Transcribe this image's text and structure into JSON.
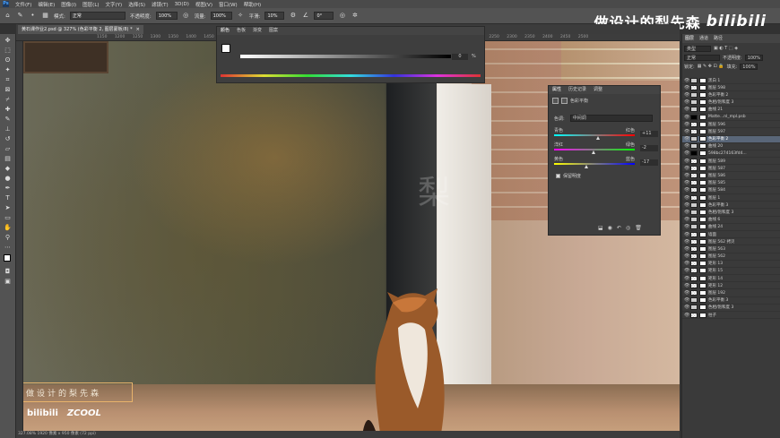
{
  "menubar": {
    "items": [
      "文件(F)",
      "编辑(E)",
      "图像(I)",
      "图层(L)",
      "文字(Y)",
      "选择(S)",
      "滤镜(T)",
      "3D(D)",
      "视图(V)",
      "窗口(W)",
      "帮助(H)"
    ]
  },
  "options": {
    "mode_label": "模式:",
    "mode_value": "正常",
    "opacity_label": "不透明度:",
    "opacity_value": "100%",
    "flow_label": "流量:",
    "flow_value": "100%",
    "smooth_label": "平滑:",
    "smooth_value": "10%",
    "angle_value": "0°"
  },
  "watermark": {
    "text": "做设计的梨先森",
    "brand": "bilibili"
  },
  "doc_tab": {
    "title": "黄石课作业2.psd @ 327% (色彩平衡 2, 图层蒙板/8) *",
    "close": "×"
  },
  "ruler_marks": "1150 1200 1250 1300 1350 1400 1450 1500 1550 1600 1650 1700 1750 1800 1850 1900 1950 2000 2050 2100 2150 2200 2250 2300 2350 2400 2450 2500",
  "canvas": {
    "watermark_char": "梨",
    "stamp_text": "做设计的梨先森",
    "logo1": "bilibili",
    "logo2": "ZCOOL"
  },
  "color_panel": {
    "tabs": [
      "颜色",
      "色板",
      "渐变",
      "图案"
    ],
    "value": "0",
    "unit": "%"
  },
  "properties": {
    "tabs": [
      "属性",
      "历史记录",
      "调整"
    ],
    "title": "色彩平衡",
    "tone_label": "色调:",
    "tone_value": "中间调",
    "sliders": [
      {
        "left": "青色",
        "right": "红色",
        "value": "+11",
        "pos": 0.55,
        "color": "linear-gradient(90deg,#0ff,#f00)"
      },
      {
        "left": "洋红",
        "right": "绿色",
        "value": "-2",
        "pos": 0.49,
        "color": "linear-gradient(90deg,#f0f,#0f0)"
      },
      {
        "left": "黄色",
        "right": "蓝色",
        "value": "-17",
        "pos": 0.41,
        "color": "linear-gradient(90deg,#ff0,#00f)"
      }
    ],
    "preserve_label": "保留明度"
  },
  "layers": {
    "tabs": [
      "图层",
      "通道",
      "路径"
    ],
    "filter_label": "类型",
    "blend": "正常",
    "opacity_label": "不透明度:",
    "opacity": "100%",
    "lock_label": "锁定:",
    "fill_label": "填充:",
    "fill": "100%",
    "rows": [
      {
        "name": "黑白 1",
        "thumb": "adj",
        "sel": false
      },
      {
        "name": "图层 598",
        "thumb": "chk",
        "sel": false
      },
      {
        "name": "色彩平衡 2",
        "thumb": "adj",
        "sel": false
      },
      {
        "name": "色相/饱和度 3",
        "thumb": "adj",
        "sel": false
      },
      {
        "name": "曲线 21",
        "thumb": "adj",
        "sel": false
      },
      {
        "name": "Matte...nl_mpl.psb",
        "thumb": "blk",
        "sel": false
      },
      {
        "name": "图层 596",
        "thumb": "chk",
        "sel": false
      },
      {
        "name": "图层 597",
        "thumb": "chk",
        "sel": false
      },
      {
        "name": "色彩平衡 2",
        "thumb": "adj",
        "sel": true
      },
      {
        "name": "曲线 20",
        "thumb": "adj",
        "sel": false
      },
      {
        "name": "598bc274163fd4...",
        "thumb": "blk",
        "sel": false
      },
      {
        "name": "图层 589",
        "thumb": "chk",
        "sel": false
      },
      {
        "name": "图层 587",
        "thumb": "chk",
        "sel": false
      },
      {
        "name": "图层 586",
        "thumb": "chk",
        "sel": false
      },
      {
        "name": "图层 585",
        "thumb": "chk",
        "sel": false
      },
      {
        "name": "图层 584",
        "thumb": "chk",
        "sel": false
      },
      {
        "name": "图层 1",
        "thumb": "chk",
        "sel": false
      },
      {
        "name": "色彩平衡 3",
        "thumb": "adj",
        "sel": false
      },
      {
        "name": "色相/饱和度 3",
        "thumb": "adj",
        "sel": false
      },
      {
        "name": "曲线 6",
        "thumb": "adj",
        "sel": false
      },
      {
        "name": "曲线 24",
        "thumb": "adj",
        "sel": false
      },
      {
        "name": "墙面",
        "thumb": "chk",
        "sel": false
      },
      {
        "name": "图层 562 拷贝",
        "thumb": "chk",
        "sel": false
      },
      {
        "name": "图层 563",
        "thumb": "chk",
        "sel": false
      },
      {
        "name": "图层 562",
        "thumb": "chk",
        "sel": false
      },
      {
        "name": "矩形 13",
        "thumb": "chk",
        "sel": false
      },
      {
        "name": "矩形 15",
        "thumb": "chk",
        "sel": false
      },
      {
        "name": "矩形 14",
        "thumb": "chk",
        "sel": false
      },
      {
        "name": "矩形 12",
        "thumb": "chk",
        "sel": false
      },
      {
        "name": "图层 192",
        "thumb": "chk",
        "sel": false
      },
      {
        "name": "色彩平衡 3",
        "thumb": "adj",
        "sel": false
      },
      {
        "name": "色相/饱和度 3",
        "thumb": "adj",
        "sel": false
      },
      {
        "name": "柱子",
        "thumb": "chk",
        "sel": false
      }
    ]
  },
  "status": {
    "text": "327.08%    1920 像素 x 950 像素 (72 ppi)"
  }
}
